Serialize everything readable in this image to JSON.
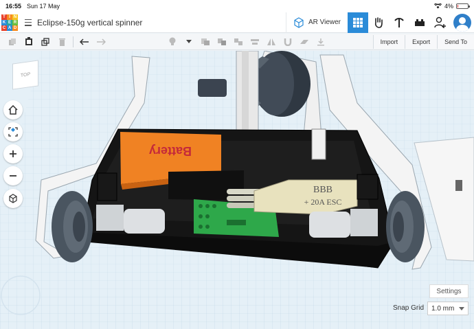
{
  "status_bar": {
    "time": "16:55",
    "date": "Sun 17 May",
    "battery": "4%"
  },
  "logo": {
    "letters": [
      "T",
      "I",
      "N",
      "K",
      "E",
      "R",
      "C",
      "A",
      "D"
    ]
  },
  "header": {
    "title": "Eclipse-150g vertical spinner",
    "ar_viewer_label": "AR Viewer"
  },
  "toolbar": {
    "import_label": "Import",
    "export_label": "Export",
    "send_to_label": "Send To"
  },
  "viewcube": {
    "label": "TOP"
  },
  "model": {
    "battery_text": "Battery",
    "esc_line1": "BBB",
    "esc_line2": "+ 20A ESC"
  },
  "footer": {
    "settings_label": "Settings",
    "snap_grid_label": "Snap Grid",
    "snap_grid_value": "1.0 mm"
  },
  "colors": {
    "accent": "#2a8bd8",
    "battery": "#f08223",
    "pcb": "#2ea84a",
    "chassis": "#151515",
    "wheel": "#4a5560"
  }
}
